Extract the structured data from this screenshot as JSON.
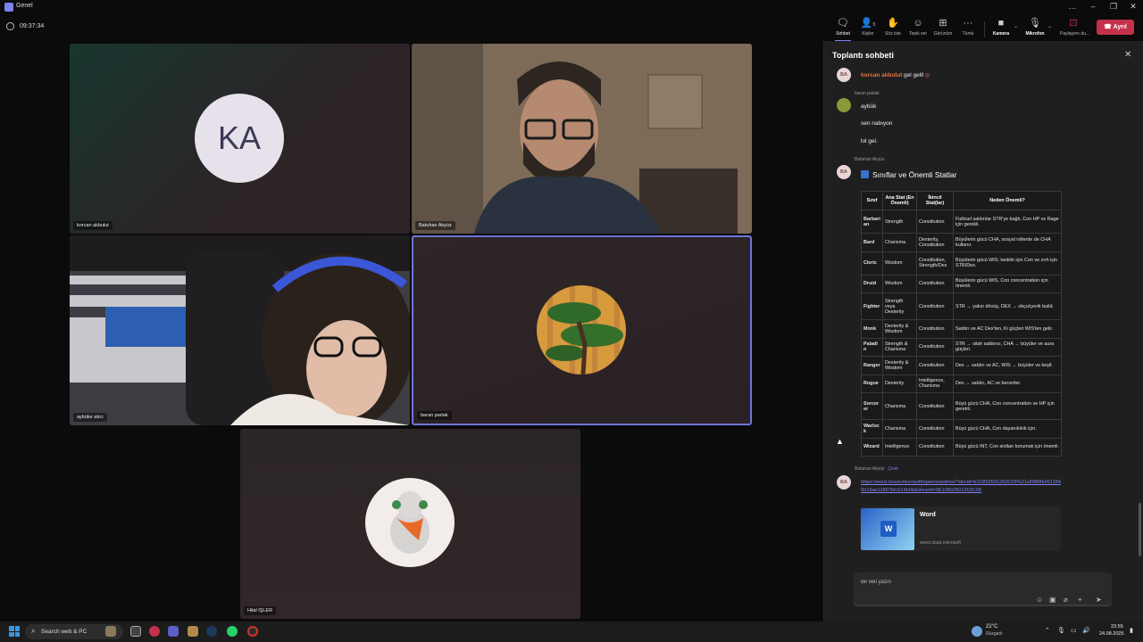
{
  "window": {
    "title": "Genel",
    "controls": [
      "…",
      "–",
      "❐",
      "✕"
    ]
  },
  "toolbar": {
    "timer": "09:37:34",
    "buttons": [
      {
        "label": "Sohbet",
        "icon": "chat-icon"
      },
      {
        "label": "Kişiler",
        "icon": "people-icon",
        "badge": "5"
      },
      {
        "label": "Söz iste",
        "icon": "raise-hand-icon"
      },
      {
        "label": "Tepki ver",
        "icon": "reaction-icon"
      },
      {
        "label": "Görünüm",
        "icon": "view-icon"
      },
      {
        "label": "Tümü",
        "icon": "more-icon"
      },
      {
        "label": "Kamera",
        "icon": "camera-icon"
      },
      {
        "label": "Mikrofon",
        "icon": "mic-icon"
      },
      {
        "label": "Paylaşımı du...",
        "icon": "share-icon"
      }
    ],
    "leave_label": "Ayrıl"
  },
  "stage": {
    "participants": [
      {
        "name": "korcan akbulut",
        "initials": "KA"
      },
      {
        "name": "Batuhan Akyüz"
      },
      {
        "name": "aybüke atıcı"
      },
      {
        "name": "baran parlak"
      },
      {
        "name": "Hilal İŞLER"
      }
    ]
  },
  "chat": {
    "title": "Toplantı sohbeti",
    "messages": [
      {
        "avatar": "BA",
        "mention": "korcan akbulut",
        "text": "gel gelll"
      },
      {
        "sender": "baran parlak",
        "lines": [
          "aybük",
          "sen nabıyon",
          "lol gel."
        ]
      },
      {
        "sender": "Batuhan Akyüz",
        "avatar": "BA",
        "heading": "Sınıflar ve Önemli Statlar"
      },
      {
        "sender": "Batuhan Akyüz",
        "translate": "Çevir",
        "avatar": "BA",
        "link": "https://word.cloud.microsoft/open/onedrive/?docid=E10892501263C09%21s898f8b4511840b19ae11807bfc514b0b&driveId=0E10892501263C09"
      }
    ],
    "table": {
      "headers": [
        "Sınıf",
        "Ana Stat (En Önemli)",
        "İkincil Stat(lar)",
        "Neden Önemli?"
      ],
      "rows": [
        [
          "Barbarian",
          "Strength",
          "Constitution",
          "Fiziksel saldırılar STR'ye bağlı, Con HP ve Rage için gerekli."
        ],
        [
          "Bard",
          "Charisma",
          "Dexterity, Constitution",
          "Büyülerin gücü CHA, sosyal rollerde de CHA kullanır."
        ],
        [
          "Cleric",
          "Wisdom",
          "Constitution, Strength/Dex",
          "Büyülerin gücü WIS; tanklık için Con ve zırh için STR/Dex."
        ],
        [
          "Druid",
          "Wisdom",
          "Constitution",
          "Büyülerin gücü WIS, Con concentration için önemli."
        ],
        [
          "Fighter",
          "Strength veya Dexterity",
          "Constitution",
          "STR → yakın dövüş, DEX → okçu/çevik build."
        ],
        [
          "Monk",
          "Dexterity & Wisdom",
          "Constitution",
          "Saldırı ve AC Dex'ten, Ki güçleri WIS'ten gelir."
        ],
        [
          "Paladin",
          "Strength & Charisma",
          "Constitution",
          "STR → silah saldırısı, CHA → büyüler ve aura güçleri."
        ],
        [
          "Ranger",
          "Dexterity & Wisdom",
          "Constitution",
          "Dex → saldırı ve AC, WIS → büyüler ve keşif."
        ],
        [
          "Rogue",
          "Dexterity",
          "Intelligence, Charisma",
          "Dex → saldırı, AC ve beceriler."
        ],
        [
          "Sorcerer",
          "Charisma",
          "Constitution",
          "Büyü gücü CHA, Con concentration ve HP için gerekli."
        ],
        [
          "Warlock",
          "Charisma",
          "Constitution",
          "Büyü gücü CHA, Con dayanıklılık için."
        ],
        [
          "Wizard",
          "Intelligence",
          "Constitution",
          "Büyü gücü INT, Con slotları korumak için önemli."
        ]
      ]
    },
    "link_card": {
      "title": "Word",
      "domain": "word.cloud.microsoft"
    },
    "compose_placeholder": "Bir ileti yazın"
  },
  "taskbar": {
    "search": "Search web & PC",
    "weather_temp": "22°C",
    "weather_desc": "Rüzgarlı",
    "time": "23:55",
    "date": "24.08.2025"
  },
  "colors": {
    "accent": "#7b83eb",
    "leave": "#c4314b",
    "mention": "#e97548",
    "link": "#7f85f5"
  }
}
